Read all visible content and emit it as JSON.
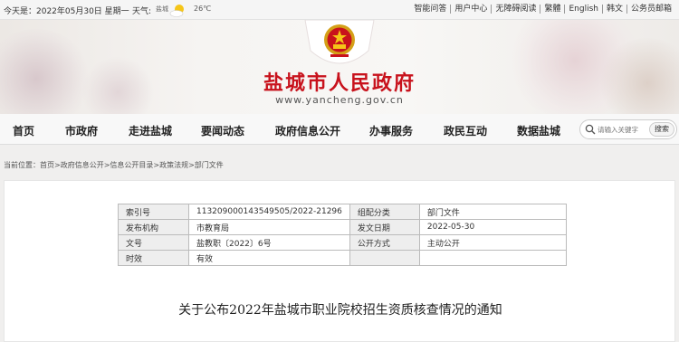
{
  "topbar": {
    "date": "今天是：2022年05月30日 星期一",
    "weather_label": "天气:",
    "weather_city": "盐城",
    "weather_icon": "sun-cloud-icon",
    "temperature": "26℃",
    "links": [
      "智能问答",
      "用户中心",
      "无障碍阅读",
      "繁體",
      "English",
      "韩文",
      "公务员邮箱"
    ]
  },
  "banner": {
    "title": "盐城市人民政府",
    "url": "www.yancheng.gov.cn",
    "emblem_icon": "national-emblem-icon"
  },
  "nav": {
    "items": [
      "首页",
      "市政府",
      "走进盐城",
      "要闻动态",
      "政府信息公开",
      "办事服务",
      "政民互动",
      "数据盐城"
    ],
    "search_placeholder": "请输入关键字",
    "search_button": "搜索"
  },
  "breadcrumb": "当前位置：首页>政府信息公开>信息公开目录>政策法规>部门文件",
  "meta": {
    "index_label": "索引号",
    "index_value": "113209000143549505/2022-21296",
    "category_label": "组配分类",
    "category_value": "部门文件",
    "publisher_label": "发布机构",
    "publisher_value": "市教育局",
    "date_label": "发文日期",
    "date_value": "2022-05-30",
    "docno_label": "文号",
    "docno_value": "盐教职〔2022〕6号",
    "mode_label": "公开方式",
    "mode_value": "主动公开",
    "validity_label": "时效",
    "validity_value": "有效"
  },
  "document": {
    "title": "关于公布2022年盐城市职业院校招生资质核查情况的通知"
  },
  "colors": {
    "title_red": "#c8121c",
    "nav_bg": "#f8f8f8",
    "label_bg": "#eeeeee"
  }
}
